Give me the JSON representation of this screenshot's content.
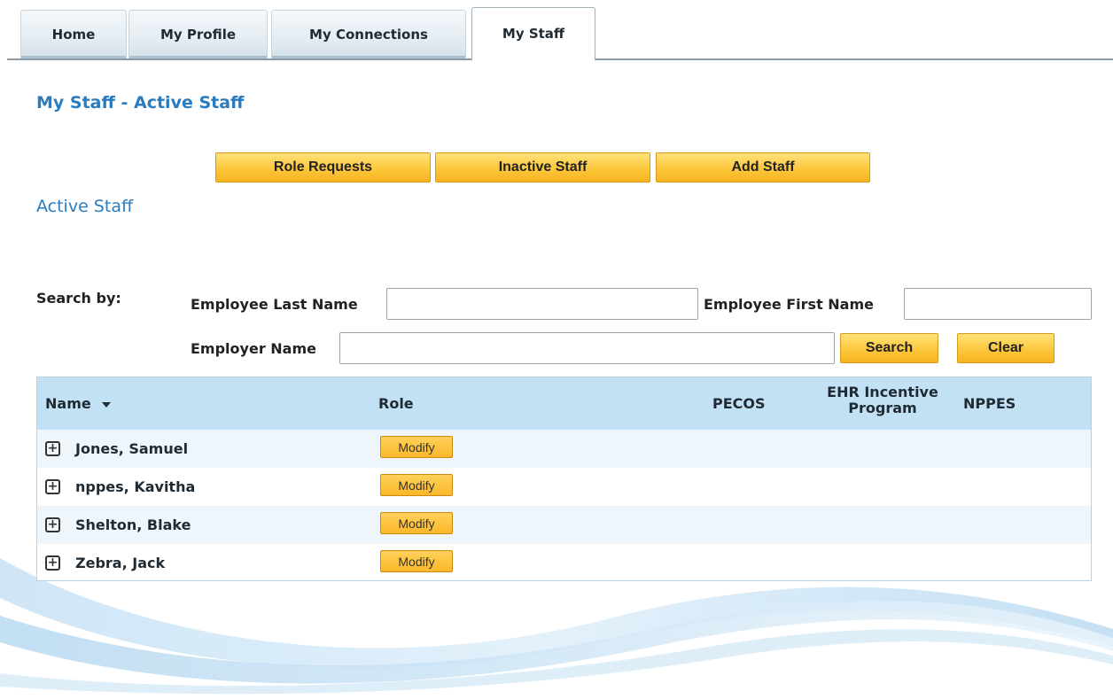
{
  "tabs": [
    {
      "label": "Home"
    },
    {
      "label": "My Profile"
    },
    {
      "label": "My Connections"
    },
    {
      "label": "My Staff"
    }
  ],
  "active_tab": "My Staff",
  "page_title": "My Staff - Active Staff",
  "actions": {
    "role_requests": "Role Requests",
    "inactive_staff": "Inactive Staff",
    "add_staff": "Add Staff"
  },
  "section_title": "Active Staff",
  "search": {
    "search_by_label": "Search by:",
    "last_name_label": "Employee Last Name",
    "last_name_value": "",
    "first_name_label": "Employee First Name",
    "first_name_value": "",
    "employer_label": "Employer Name",
    "employer_value": "",
    "search_button": "Search",
    "clear_button": "Clear"
  },
  "table": {
    "headers": {
      "name": "Name",
      "role": "Role",
      "pecos": "PECOS",
      "ehr_line1": "EHR Incentive",
      "ehr_line2": "Program",
      "nppes": "NPPES"
    },
    "sort_icon": "caret-down-icon",
    "expand_icon": "plus-box-icon",
    "rows": [
      {
        "name": "Jones, Samuel",
        "action": "Modify"
      },
      {
        "name": "nppes, Kavitha",
        "action": "Modify"
      },
      {
        "name": "Shelton, Blake",
        "action": "Modify"
      },
      {
        "name": "Zebra, Jack",
        "action": "Modify"
      }
    ]
  },
  "colors": {
    "title_blue": "#2a7cc0",
    "header_blue": "#c3e1f5",
    "button_gold": "#fcc73c"
  }
}
